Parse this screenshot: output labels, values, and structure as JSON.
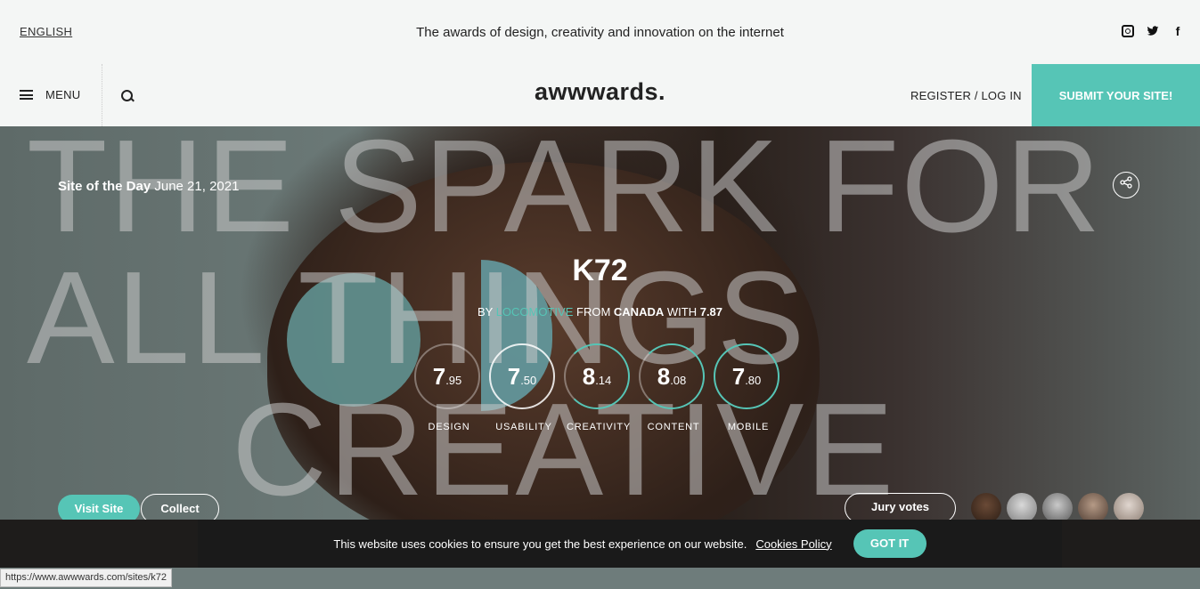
{
  "topbar": {
    "language": "ENGLISH",
    "tagline": "The awards of design, creativity and innovation on the internet",
    "social": [
      "instagram-icon",
      "twitter-icon",
      "facebook-icon"
    ],
    "facebook_glyph": "f"
  },
  "nav": {
    "menu_label": "MENU",
    "logo": "awwwards.",
    "register_label": "REGISTER / LOG IN",
    "submit_label": "SUBMIT YOUR SITE!"
  },
  "hero": {
    "bg_lines": [
      "THE SPARK FOR",
      "ALL  THINGS",
      "CREATIVE"
    ],
    "award": "Site of the Day",
    "date": "June 21, 2021",
    "site_title": "K72",
    "by": "BY",
    "agency": "LOCOMOTIVE",
    "from": "FROM",
    "country": "CANADA",
    "with": "WITH",
    "overall": "7.87",
    "scores": [
      {
        "int": "7",
        "dec": ".95",
        "label": "DESIGN"
      },
      {
        "int": "7",
        "dec": ".50",
        "label": "USABILITY"
      },
      {
        "int": "8",
        "dec": ".14",
        "label": "CREATIVITY"
      },
      {
        "int": "8",
        "dec": ".08",
        "label": "CONTENT"
      },
      {
        "int": "7",
        "dec": ".80",
        "label": "MOBILE"
      }
    ],
    "visit_label": "Visit Site",
    "collect_label": "Collect",
    "jury_label": "Jury votes"
  },
  "cookie": {
    "text": "This website uses cookies to ensure you get the best experience on our website.",
    "policy": "Cookies Policy",
    "button": "GOT IT"
  },
  "status_url": "https://www.awwwards.com/sites/k72",
  "colors": {
    "accent": "#56c5b6",
    "dark": "#1a1a1a"
  }
}
